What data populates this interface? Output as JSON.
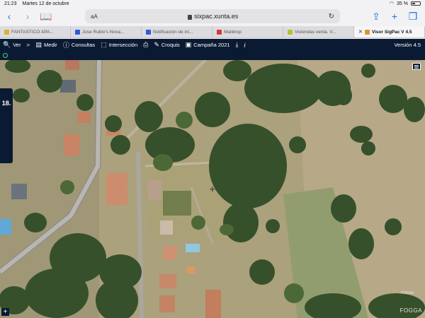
{
  "status": {
    "time": "21:23",
    "date": "Martes 12 de octubre",
    "battery": "35 %"
  },
  "browser": {
    "reader_label": "aA",
    "url": "sixpac.xunta.es",
    "tabs": [
      {
        "label": "FANTASTICO APA...",
        "color": "#d8b52a"
      },
      {
        "label": "Jose Rubio's Nova...",
        "color": "#2a5bd8"
      },
      {
        "label": "Notificación de ini...",
        "color": "#2a5bd8"
      },
      {
        "label": "Maildrop",
        "color": "#d83a2a"
      },
      {
        "label": "Viviendas venta. V...",
        "color": "#b8c22a"
      },
      {
        "label": "Visor SigPac V 4.5",
        "color": "#d8962a",
        "active": true
      }
    ]
  },
  "app": {
    "tools": [
      {
        "icon": "magnifier-icon",
        "glyph": "🔍",
        "label": "Ver"
      },
      {
        "icon": "binoculars-icon",
        "glyph": "⌕",
        "label": ""
      },
      {
        "icon": "ruler-icon",
        "glyph": "▤",
        "label": "Medir"
      },
      {
        "icon": "info-icon",
        "glyph": "ⓘ",
        "label": "Consultas"
      },
      {
        "icon": "intersection-icon",
        "glyph": "⬚",
        "label": "Intersección"
      },
      {
        "icon": "printer-icon",
        "glyph": "⎙",
        "label": ""
      },
      {
        "icon": "pencil-icon",
        "glyph": "✎",
        "label": "Croquis"
      },
      {
        "icon": "calendar-icon",
        "glyph": "▣",
        "label": "Campaña 2021"
      },
      {
        "icon": "download-icon",
        "glyph": "⤓",
        "label": ""
      },
      {
        "icon": "info-italic-icon",
        "glyph": "i",
        "label": ""
      }
    ],
    "version": "Versión 4.5"
  },
  "map": {
    "side_label": "18.",
    "watermark": "FOGGA",
    "watermark_small": "FOGGA"
  }
}
